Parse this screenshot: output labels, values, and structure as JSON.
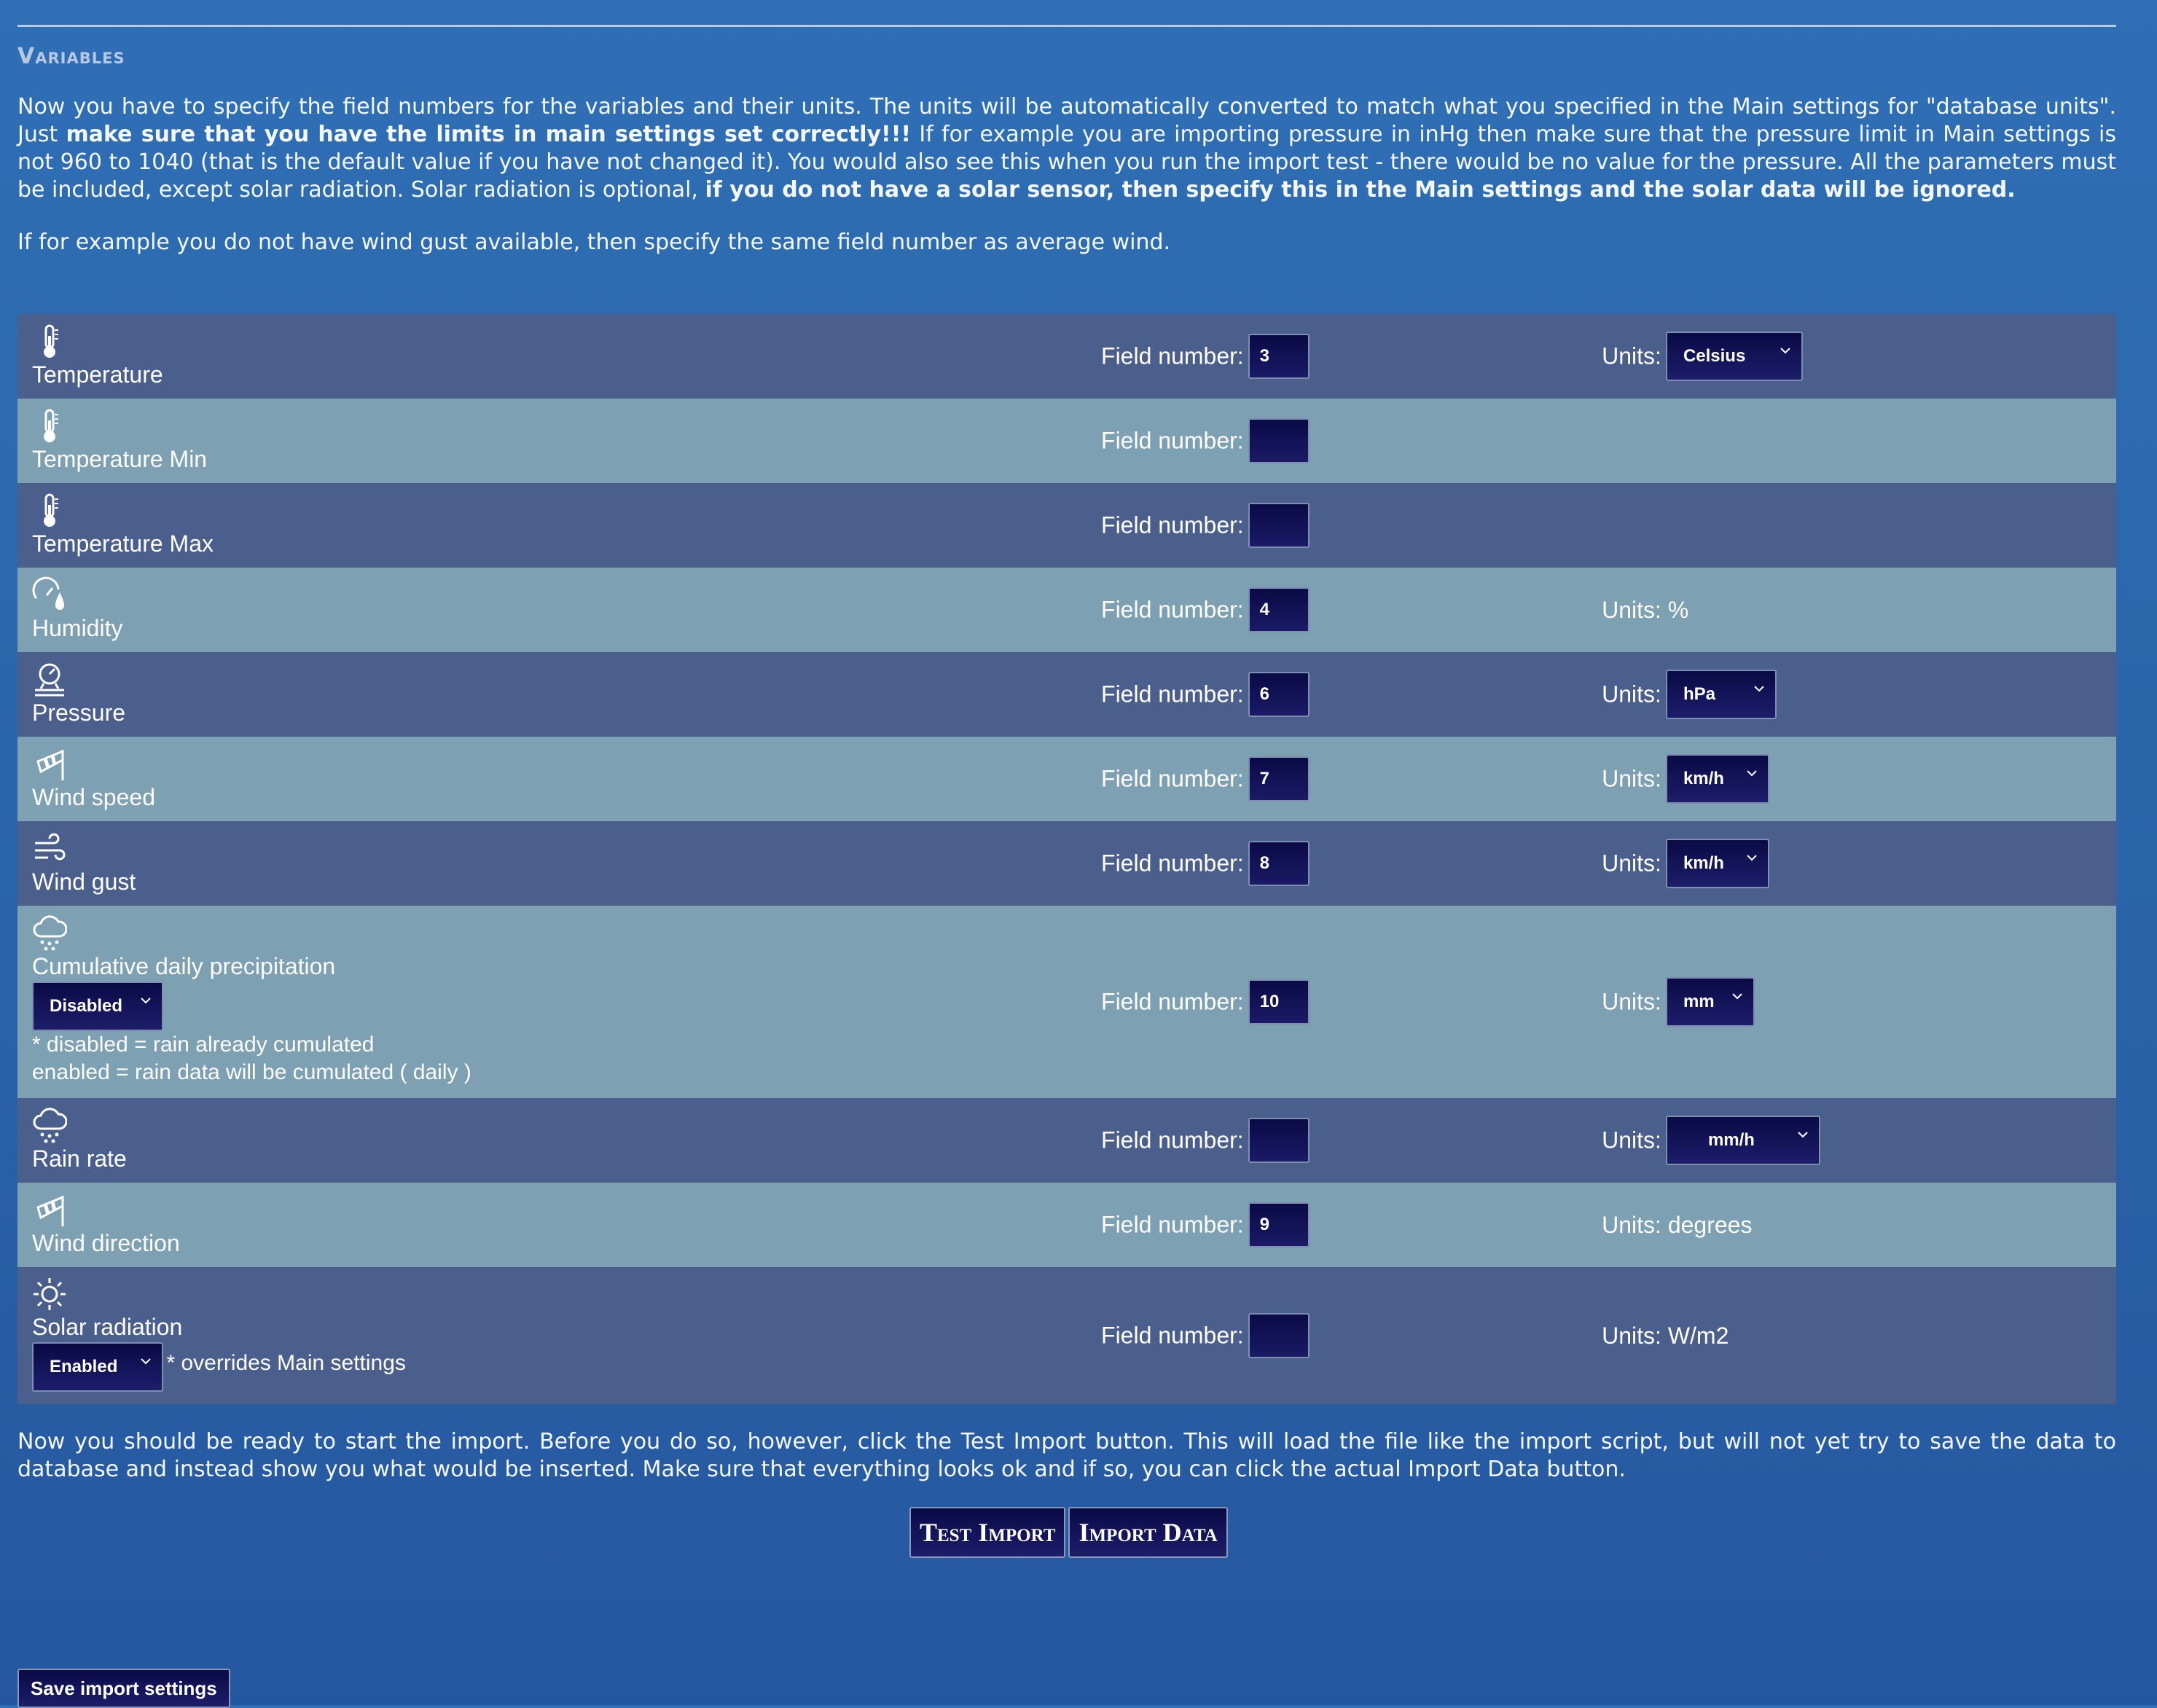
{
  "section_title": "Variables",
  "intro": {
    "p1": "Now you have to specify the field numbers for the variables and their units. The units will be automatically converted to match what you specified in the Main settings for \"database units\". Just ",
    "b1": "make sure that you have the limits in main settings set correctly!!!",
    "p2": " If for example you are importing pressure in inHg then make sure that the pressure limit in Main settings is not 960 to 1040 (that is the default value if you have not changed it). You would also see this when you run the import test - there would be no value for the pressure. All the parameters must be included, except solar radiation. Solar radiation is optional, ",
    "b2": "if you do not have a solar sensor, then specify this in the Main settings and the solar data will be ignored."
  },
  "note": "If for example you do not have wind gust available, then specify the same field number as average wind.",
  "field_label": "Field number:",
  "units_label": "Units:",
  "rows": [
    {
      "name": "Temperature",
      "icon": "thermometer-icon",
      "field": "3",
      "units": "Celsius"
    },
    {
      "name": "Temperature Min",
      "icon": "thermometer-icon",
      "field": ""
    },
    {
      "name": "Temperature Max",
      "icon": "thermometer-icon",
      "field": ""
    },
    {
      "name": "Humidity",
      "icon": "humidity-icon",
      "field": "4",
      "units_text": "Units: %"
    },
    {
      "name": "Pressure",
      "icon": "barometer-icon",
      "field": "6",
      "units": "hPa"
    },
    {
      "name": "Wind speed",
      "icon": "windsock-icon",
      "field": "7",
      "units": "km/h"
    },
    {
      "name": "Wind gust",
      "icon": "wind-icon",
      "field": "8",
      "units": "km/h"
    },
    {
      "name": "Cumulative daily precipitation",
      "icon": "rain-cloud-icon",
      "field": "10",
      "units": "mm",
      "mode": "Disabled",
      "help1": "* disabled = rain already cumulated",
      "help2": "enabled = rain data will be cumulated ( daily )"
    },
    {
      "name": "Rain rate",
      "icon": "rain-cloud-icon",
      "field": "",
      "units": "mm/h"
    },
    {
      "name": "Wind direction",
      "icon": "windsock-icon",
      "field": "9",
      "units_text": "Units: degrees"
    },
    {
      "name": "Solar radiation",
      "icon": "sun-icon",
      "field": "",
      "units_text": "Units: W/m2",
      "mode": "Enabled",
      "help1": "* overrides Main settings"
    }
  ],
  "outro": "Now you should be ready to start the import. Before you do so, however, click the Test Import button. This will load the file like the import script, but will not yet try to save the data to database and instead show you what would be inserted. Make sure that everything looks ok and if so, you can click the actual Import Data button.",
  "buttons": {
    "test": "Test Import",
    "import": "Import Data",
    "save": "Save import settings"
  }
}
